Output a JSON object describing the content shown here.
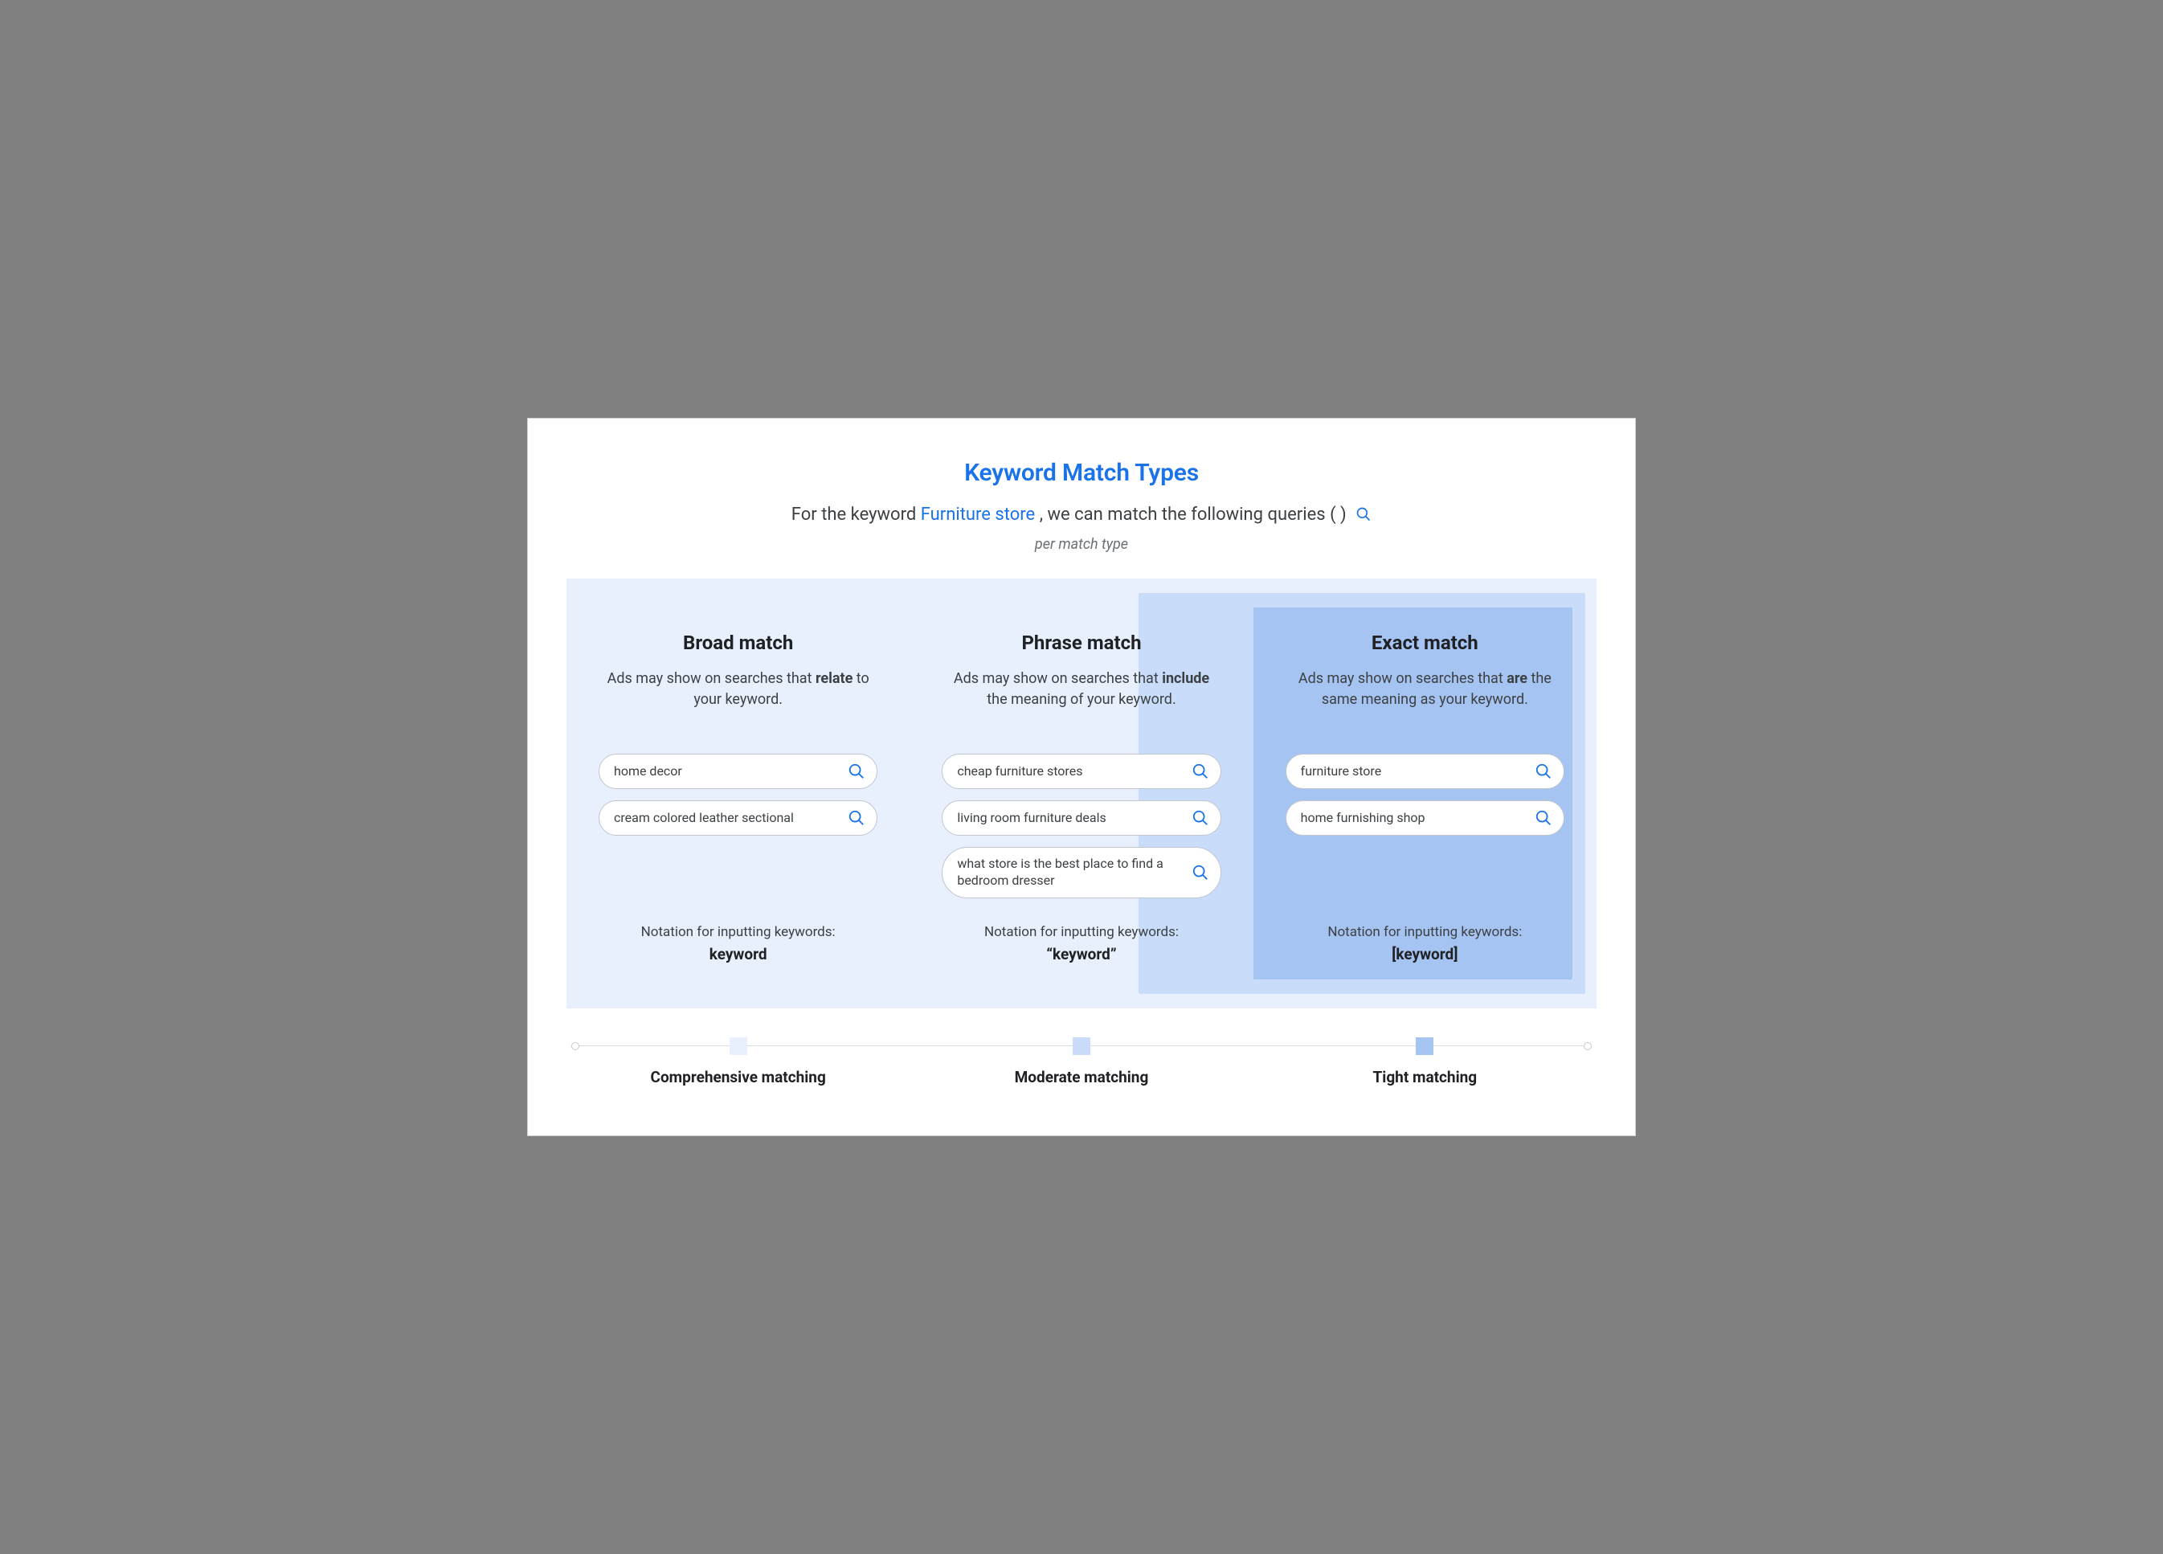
{
  "header": {
    "title": "Keyword Match Types",
    "subtitle_pre": "For the keyword ",
    "keyword": "Furniture store",
    "subtitle_post": ", we can match the following queries (     )",
    "per_type": "per match type"
  },
  "columns": [
    {
      "title": "Broad match",
      "desc_pre": "Ads may show on searches that ",
      "desc_bold": "relate",
      "desc_post": " to your keyword.",
      "queries": [
        "home decor",
        "cream colored leather sectional"
      ],
      "notation_label": "Notation for inputting keywords:",
      "notation_value": "keyword"
    },
    {
      "title": "Phrase match",
      "desc_pre": "Ads may show on searches that ",
      "desc_bold": "include",
      "desc_post": " the meaning of your keyword.",
      "queries": [
        "cheap furniture stores",
        "living room furniture deals",
        "what store is the best place to find a bedroom dresser"
      ],
      "notation_label": "Notation for inputting keywords:",
      "notation_value": "“keyword”"
    },
    {
      "title": "Exact match",
      "desc_pre": "Ads may show on searches that ",
      "desc_bold": "are",
      "desc_post": " the same meaning as your keyword.",
      "queries": [
        "furniture store",
        "home furnishing shop"
      ],
      "notation_label": "Notation for inputting keywords:",
      "notation_value": "[keyword]"
    }
  ],
  "scale": [
    "Comprehensive matching",
    "Moderate matching",
    "Tight matching"
  ],
  "icons": {
    "search": "search-icon"
  }
}
